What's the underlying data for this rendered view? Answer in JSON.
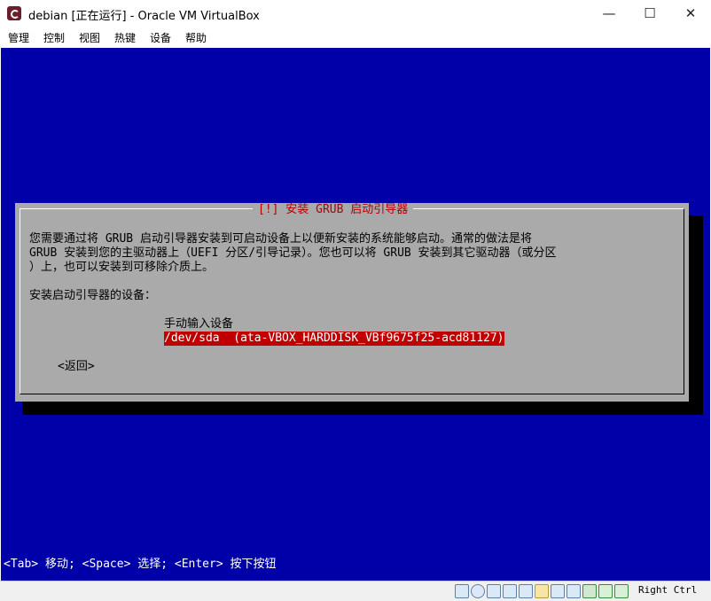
{
  "window": {
    "title": "debian [正在运行] - Oracle VM VirtualBox",
    "minimize": "—",
    "maximize": "☐",
    "close": "✕"
  },
  "menu": [
    "管理",
    "控制",
    "视图",
    "热键",
    "设备",
    "帮助"
  ],
  "installer": {
    "dialog_title": "[!] 安装 GRUB 启动引导器",
    "description_lines": [
      "您需要通过将 GRUB 启动引导器安装到可启动设备上以便新安装的系统能够启动。通常的做法是将",
      "GRUB 安装到您的主驱动器上（UEFI 分区/引导记录）。您也可以将 GRUB 安装到其它驱动器（或分区",
      "）上，也可以安装到可移除介质上。"
    ],
    "prompt": "安装启动引导器的设备：",
    "options": [
      "手动输入设备",
      "/dev/sda  (ata-VBOX_HARDDISK_VBf9675f25-acd81127)"
    ],
    "selected_index": 1,
    "back_button": "<返回>",
    "status_line": "<Tab> 移动; <Space> 选择; <Enter> 按下按钮"
  },
  "statusbar": {
    "icons": [
      "hard-disk-icon",
      "optical-drive-icon",
      "audio-icon",
      "network-icon",
      "usb-icon",
      "shared-folder-icon",
      "display-icon",
      "recording-icon",
      "cpu-icon",
      "mouse-integration-icon",
      "keyboard-icon"
    ],
    "host_key": "Right Ctrl"
  },
  "colors": {
    "screen_bg": "#0000a8",
    "dialog_bg": "#aaaaaa",
    "title_red": "#b00000",
    "selection_bg": "#c00000"
  }
}
